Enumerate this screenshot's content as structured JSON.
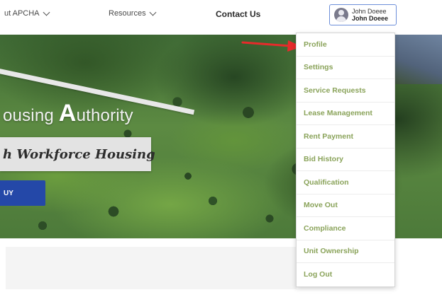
{
  "nav": {
    "about_label": "ut APCHA",
    "resources_label": "Resources",
    "contact_label": "Contact Us",
    "user": {
      "line1": "John Doeee",
      "line2": "John Doeee"
    }
  },
  "hero": {
    "title_pre": "ousing ",
    "title_big_a": "A",
    "title_post": "uthority",
    "banner_text": "h Workforce Housing",
    "button_label": "UY"
  },
  "dropdown": {
    "items": [
      "Profile",
      "Settings",
      "Service Requests",
      "Lease Management",
      "Rent Payment",
      "Bid History",
      "Qualification",
      "Move Out",
      "Compliance",
      "Unit Ownership",
      "Log Out"
    ]
  },
  "colors": {
    "menu_text": "#8aa35a",
    "arrow": "#e52b2b",
    "hero_button": "#2448a8",
    "user_border": "#6d8fd9"
  }
}
